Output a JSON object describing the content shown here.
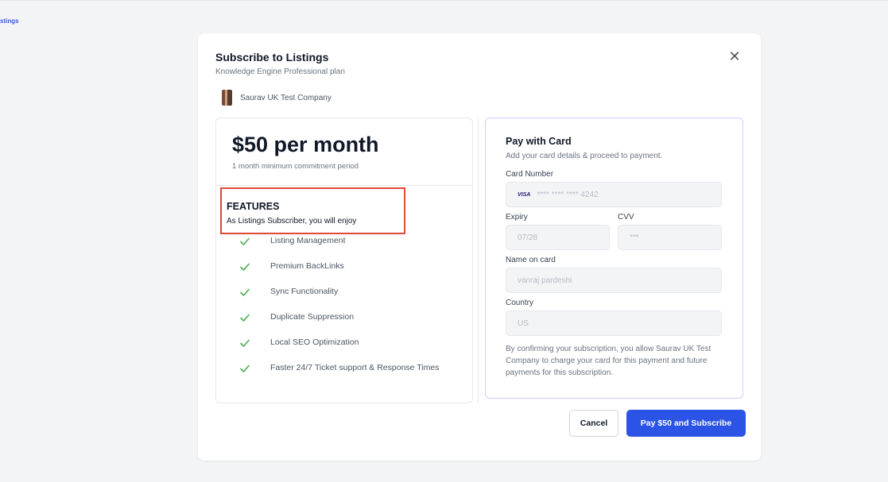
{
  "background": {
    "link_text": "stings"
  },
  "modal": {
    "title": "Subscribe to Listings",
    "subtitle": "Knowledge Engine Professional plan",
    "close_glyph": "✕",
    "company_name": "Saurav UK Test Company"
  },
  "plan": {
    "price": "$50 per month",
    "commitment": "1 month minimum commitment period",
    "features_title": "FEATURES",
    "features_subtitle": "As Listings Subscriber, you will enjoy",
    "features": [
      {
        "label": "Listing Management"
      },
      {
        "label": "Premium BackLinks"
      },
      {
        "label": "Sync Functionality"
      },
      {
        "label": "Duplicate Suppression"
      },
      {
        "label": "Local SEO Optimization"
      },
      {
        "label": "Faster 24/7 Ticket support & Response Times"
      }
    ]
  },
  "payment": {
    "title": "Pay with Card",
    "subtitle": "Add your card details & proceed to payment.",
    "card_number_label": "Card Number",
    "card_brand": "VISA",
    "card_number_value": "**** **** **** 4242",
    "expiry_label": "Expiry",
    "expiry_value": "07/28",
    "cvv_label": "CVV",
    "cvv_value": "***",
    "name_label": "Name on card",
    "name_value": "vanraj pardeshi",
    "country_label": "Country",
    "country_value": "US",
    "consent": "By confirming your subscription, you allow Saurav UK Test Company to charge your card for this payment and future payments for this subscription."
  },
  "actions": {
    "cancel_label": "Cancel",
    "pay_label": "Pay $50 and Subscribe"
  },
  "colors": {
    "accent": "#2b54e6",
    "check": "#4caf50",
    "highlight": "#e0483a"
  }
}
